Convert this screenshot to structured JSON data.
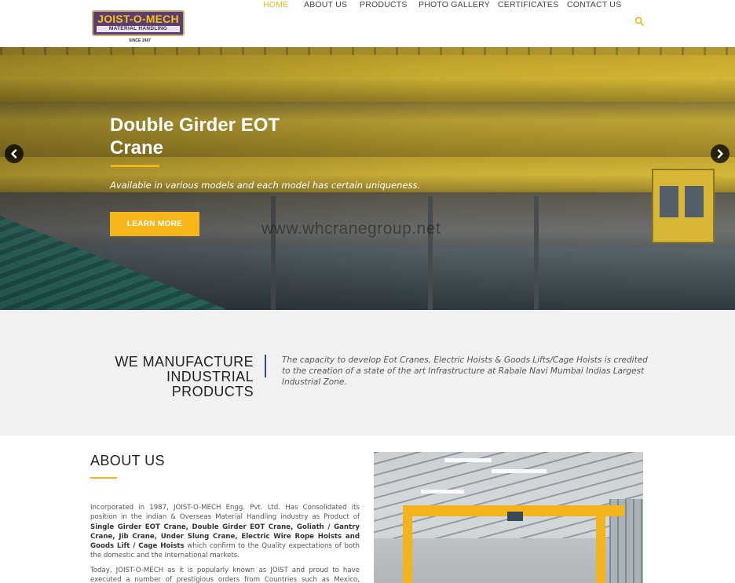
{
  "header": {
    "logo": {
      "name": "JOIST-O-MECH",
      "tagline": "MATERIAL HANDLING",
      "since": "SINCE 1987"
    },
    "nav": [
      {
        "label": "HOME",
        "active": true
      },
      {
        "label": "ABOUT US",
        "active": false
      },
      {
        "label": "PRODUCTS",
        "active": false
      },
      {
        "label": "PHOTO GALLERY",
        "active": false
      },
      {
        "label": "CERTIFICATES",
        "active": false
      },
      {
        "label": "CONTACT US",
        "active": false
      }
    ],
    "search_icon": "search-icon"
  },
  "hero": {
    "title": "Double Girder EOT Crane",
    "subtitle": "Available in various models and each model has certain uniqueness.",
    "button": "LEARN MORE",
    "watermark": "www.whcranegroup.net",
    "prev_icon": "chevron-left-icon",
    "next_icon": "chevron-right-icon"
  },
  "manufacture": {
    "title": "WE MANUFACTURE INDUSTRIAL PRODUCTS",
    "text": "The capacity to develop Eot Cranes, Electric Hoists & Goods Lifts/Cage Hoists is credited to the creation of a state of the art Infrastructure at Rabale Navi Mumbai Indias Largest Industrial Zone."
  },
  "about": {
    "title": "ABOUT US",
    "p1_lead": "Incorporated in 1987, JOIST-O-MECH Engg. Pvt. Ltd. Has Consolidated its position in the indian & Overseas Material Handling industry as Product of ",
    "p1_products": "Single Girder EOT Crane, Double Girder EOT Crane, Goliath / Gantry Crane, Jib Crane, Under Slung Crane, Electric Wire Rope Hoists and Goods Lift / Cage Hoists",
    "p1_tail": " which confirm to the Quality expectations of both the domestic and the International markets.",
    "p2": "Today, JOIST-O-MECH as it is popularly known as JOIST and proud to have executed a number of prestigious orders from Countries such as Mexico, Dubai,"
  },
  "colors": {
    "accent": "#f1b51c",
    "button": "#f6b61a",
    "logo_bg": "#5b3d6e",
    "divider": "#2c4f7c",
    "band_bg": "#f1f1f1"
  }
}
